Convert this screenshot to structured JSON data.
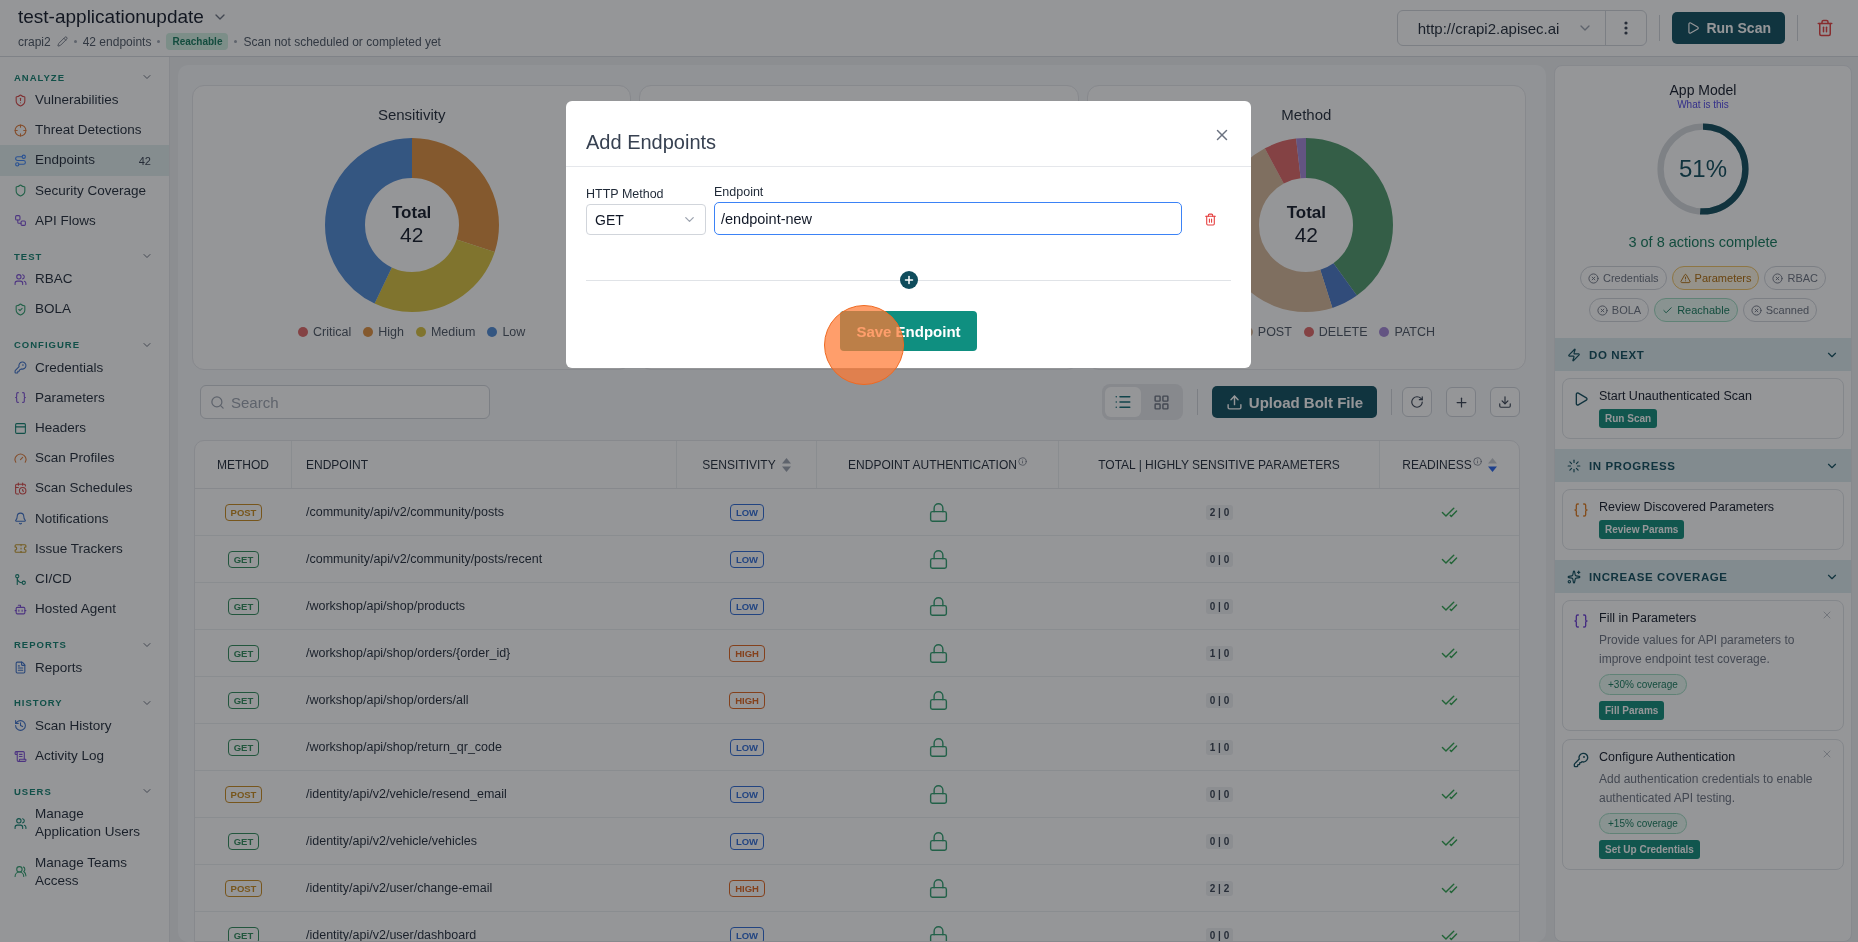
{
  "header": {
    "title": "test-applicationupdate",
    "app": "crapi2",
    "endpoint_count": "42 endpoints",
    "status_badge": "Reachable",
    "scan_status": "Scan not scheduled or completed yet",
    "url": "http://crapi2.apisec.ai",
    "run_button": "Run Scan"
  },
  "sidebar": {
    "sections": [
      {
        "title": "ANALYZE",
        "expanded": true,
        "items": [
          {
            "label": "Vulnerabilities",
            "selected": false
          },
          {
            "label": "Threat Detections",
            "selected": false
          },
          {
            "label": "Endpoints",
            "selected": true,
            "count": "42"
          },
          {
            "label": "Security Coverage",
            "selected": false
          },
          {
            "label": "API Flows",
            "selected": false
          }
        ]
      },
      {
        "title": "TEST",
        "expanded": true,
        "items": [
          {
            "label": "RBAC",
            "selected": false
          },
          {
            "label": "BOLA",
            "selected": false
          }
        ]
      },
      {
        "title": "CONFIGURE",
        "expanded": true,
        "items": [
          {
            "label": "Credentials",
            "selected": false
          },
          {
            "label": "Parameters",
            "selected": false
          },
          {
            "label": "Headers",
            "selected": false
          },
          {
            "label": "Scan Profiles",
            "selected": false
          },
          {
            "label": "Scan Schedules",
            "selected": false
          },
          {
            "label": "Notifications",
            "selected": false
          },
          {
            "label": "Issue Trackers",
            "selected": false
          },
          {
            "label": "CI/CD",
            "selected": false
          },
          {
            "label": "Hosted Agent",
            "selected": false
          }
        ]
      },
      {
        "title": "REPORTS",
        "expanded": true,
        "items": [
          {
            "label": "Reports",
            "selected": false
          }
        ]
      },
      {
        "title": "HISTORY",
        "expanded": true,
        "items": [
          {
            "label": "Scan History",
            "selected": false
          },
          {
            "label": "Activity Log",
            "selected": false
          }
        ]
      },
      {
        "title": "USERS",
        "expanded": true,
        "items": [
          {
            "label": "Manage Application Users",
            "selected": false
          },
          {
            "label": "Manage Teams Access",
            "selected": false
          }
        ]
      }
    ]
  },
  "charts": [
    {
      "title": "Sensitivity",
      "total_label": "Total",
      "total": "42",
      "legend": [
        {
          "label": "Critical",
          "kind": "critical"
        },
        {
          "label": "High",
          "kind": "high"
        },
        {
          "label": "Medium",
          "kind": "medium"
        },
        {
          "label": "Low",
          "kind": "low"
        }
      ]
    },
    {
      "title": "Method",
      "total_label": "Total",
      "total": "42",
      "legend": [
        {
          "label": "POST",
          "kind": "post"
        },
        {
          "label": "DELETE",
          "kind": "delete"
        },
        {
          "label": "PATCH",
          "kind": "patch"
        }
      ]
    }
  ],
  "toolbar": {
    "search_placeholder": "Search",
    "views": [
      {
        "kind": "list",
        "selected": true
      },
      {
        "kind": "grid",
        "selected": false
      }
    ],
    "upload_button": "Upload Bolt File"
  },
  "table": {
    "columns": [
      {
        "label": "METHOD"
      },
      {
        "label": "ENDPOINT"
      },
      {
        "label": "SENSITIVITY",
        "sortable": true,
        "sorted": false
      },
      {
        "label": "ENDPOINT AUTHENTICATION",
        "info": true
      },
      {
        "label": "TOTAL | HIGHLY SENSITIVE PARAMETERS"
      },
      {
        "label": "READINESS",
        "info": true,
        "sortable": true,
        "sorted": true
      }
    ],
    "rows": [
      {
        "method": {
          "label": "POST",
          "kind": "post"
        },
        "endpoint": "/community/api/v2/community/posts",
        "sensitivity": {
          "label": "LOW",
          "kind": "low"
        },
        "locked": true,
        "params": "2 | 0",
        "ready": true
      },
      {
        "method": {
          "label": "GET",
          "kind": "get"
        },
        "endpoint": "/community/api/v2/community/posts/recent",
        "sensitivity": {
          "label": "LOW",
          "kind": "low"
        },
        "locked": true,
        "params": "0 | 0",
        "ready": true
      },
      {
        "method": {
          "label": "GET",
          "kind": "get"
        },
        "endpoint": "/workshop/api/shop/products",
        "sensitivity": {
          "label": "LOW",
          "kind": "low"
        },
        "locked": true,
        "params": "0 | 0",
        "ready": true
      },
      {
        "method": {
          "label": "GET",
          "kind": "get"
        },
        "endpoint": "/workshop/api/shop/orders/{order_id}",
        "sensitivity": {
          "label": "HIGH",
          "kind": "high"
        },
        "locked": true,
        "params": "1 | 0",
        "ready": true
      },
      {
        "method": {
          "label": "GET",
          "kind": "get"
        },
        "endpoint": "/workshop/api/shop/orders/all",
        "sensitivity": {
          "label": "HIGH",
          "kind": "high"
        },
        "locked": true,
        "params": "0 | 0",
        "ready": true
      },
      {
        "method": {
          "label": "GET",
          "kind": "get"
        },
        "endpoint": "/workshop/api/shop/return_qr_code",
        "sensitivity": {
          "label": "LOW",
          "kind": "low"
        },
        "locked": true,
        "params": "1 | 0",
        "ready": true
      },
      {
        "method": {
          "label": "POST",
          "kind": "post"
        },
        "endpoint": "/identity/api/v2/vehicle/resend_email",
        "sensitivity": {
          "label": "LOW",
          "kind": "low"
        },
        "locked": true,
        "params": "0 | 0",
        "ready": true
      },
      {
        "method": {
          "label": "GET",
          "kind": "get"
        },
        "endpoint": "/identity/api/v2/vehicle/vehicles",
        "sensitivity": {
          "label": "LOW",
          "kind": "low"
        },
        "locked": true,
        "params": "0 | 0",
        "ready": true
      },
      {
        "method": {
          "label": "POST",
          "kind": "post"
        },
        "endpoint": "/identity/api/v2/user/change-email",
        "sensitivity": {
          "label": "HIGH",
          "kind": "high"
        },
        "locked": true,
        "params": "2 | 2",
        "ready": true
      },
      {
        "method": {
          "label": "GET",
          "kind": "get"
        },
        "endpoint": "/identity/api/v2/user/dashboard",
        "sensitivity": {
          "label": "LOW",
          "kind": "low"
        },
        "locked": true,
        "params": "0 | 0",
        "ready": true
      }
    ]
  },
  "app_model": {
    "title": "App Model",
    "help_link": "What is this",
    "level": 0.51,
    "percent": "51%",
    "summary": "3 of 8 actions complete",
    "chips": [
      {
        "label": "Credentials",
        "kind": "missing"
      },
      {
        "label": "Parameters",
        "kind": "warning"
      },
      {
        "label": "RBAC",
        "kind": "missing"
      },
      {
        "label": "BOLA",
        "kind": "missing"
      },
      {
        "label": "Reachable",
        "kind": "done"
      },
      {
        "label": "Scanned",
        "kind": "missing"
      }
    ],
    "sections": [
      {
        "title": "DO NEXT",
        "kind": "next",
        "expanded": true,
        "cards": [
          {
            "kind": "play",
            "title": "Start Unauthenticated Scan",
            "action": "Run Scan"
          }
        ]
      },
      {
        "title": "IN PROGRESS",
        "kind": "progress",
        "expanded": true,
        "cards": [
          {
            "kind": "pending-params",
            "title": "Review Discovered Parameters",
            "action": "Review Params"
          }
        ]
      },
      {
        "title": "INCREASE COVERAGE",
        "kind": "coverage",
        "expanded": true,
        "cards": [
          {
            "kind": "params",
            "title": "Fill in Parameters",
            "description": "Provide values for API parameters to improve endpoint test coverage.",
            "coverage": "+30% coverage",
            "action": "Fill Params",
            "dismissible": true
          },
          {
            "kind": "key",
            "title": "Configure Authentication",
            "description": "Add authentication credentials to enable authenticated API testing.",
            "coverage": "+15% coverage",
            "action": "Set Up Credentials",
            "dismissible": true
          }
        ]
      }
    ]
  },
  "modal": {
    "title": "Add Endpoints",
    "rows": [
      {
        "method_label": "HTTP Method",
        "method": "GET",
        "endpoint_label": "Endpoint",
        "endpoint": "/endpoint-new",
        "focused": true
      }
    ],
    "save_button": "Save Endpoint"
  }
}
